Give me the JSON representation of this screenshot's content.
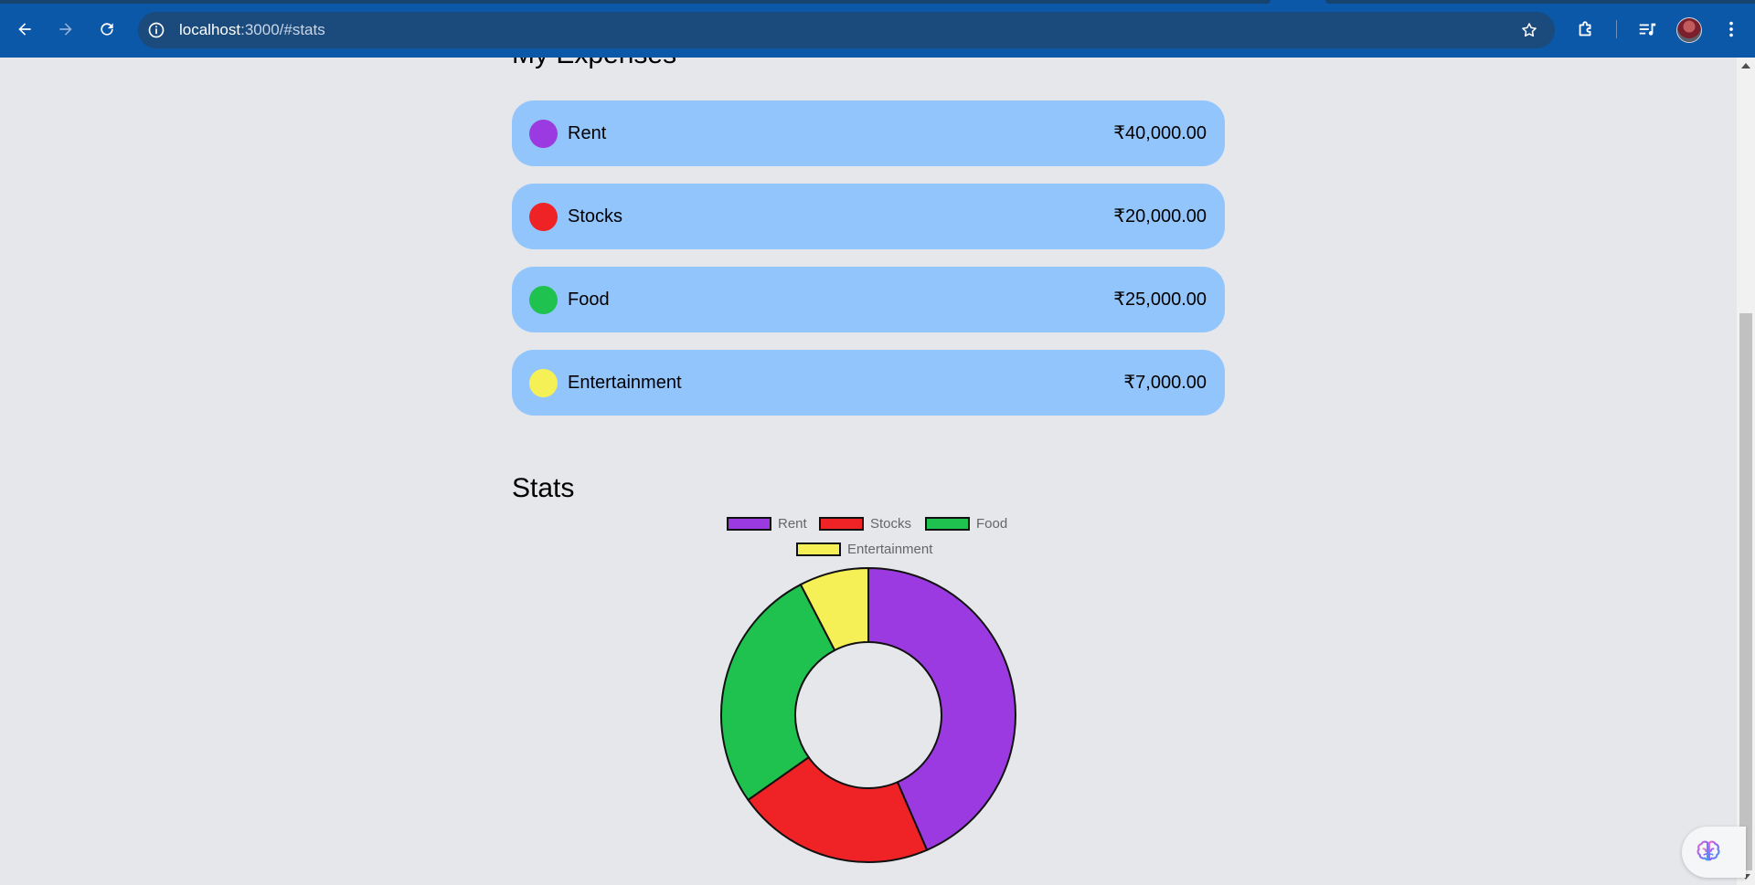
{
  "browser": {
    "url_host": "localhost",
    "url_path": ":3000/#stats"
  },
  "expenses": {
    "title": "My Expenses",
    "items": [
      {
        "label": "Rent",
        "amount": "₹40,000.00",
        "color": "#9b3ae0"
      },
      {
        "label": "Stocks",
        "amount": "₹20,000.00",
        "color": "#ef2226"
      },
      {
        "label": "Food",
        "amount": "₹25,000.00",
        "color": "#1fc24f"
      },
      {
        "label": "Entertainment",
        "amount": "₹7,000.00",
        "color": "#f5f056"
      }
    ]
  },
  "stats": {
    "title": "Stats"
  },
  "chart_data": {
    "type": "pie",
    "variant": "doughnut",
    "categories": [
      "Rent",
      "Stocks",
      "Food",
      "Entertainment"
    ],
    "values": [
      40000,
      20000,
      25000,
      7000
    ],
    "colors": [
      "#9b3ae0",
      "#ef2226",
      "#1fc24f",
      "#f5f056"
    ],
    "legend_position": "top"
  },
  "icons": {
    "back": "back-arrow-icon",
    "forward": "forward-arrow-icon",
    "reload": "reload-icon",
    "site_info": "info-icon",
    "bookmark": "star-icon",
    "extensions": "puzzle-icon",
    "media": "media-queue-icon",
    "menu": "kebab-menu-icon",
    "assistant": "brain-icon"
  }
}
